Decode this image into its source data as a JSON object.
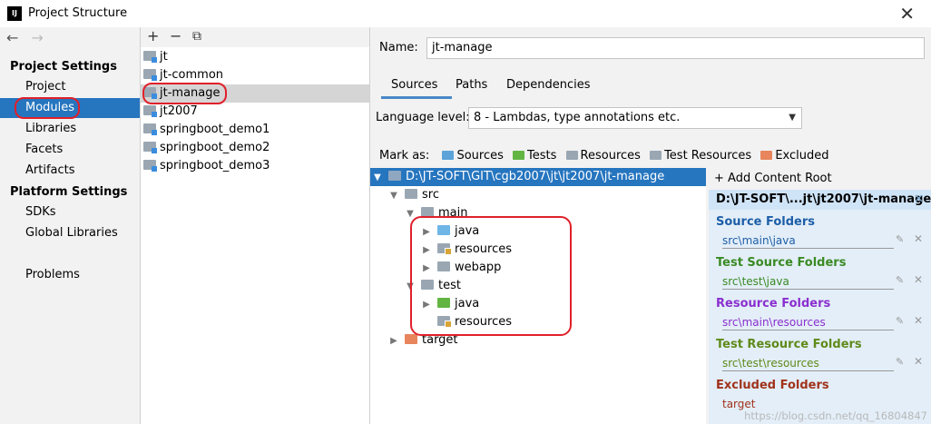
{
  "window": {
    "title": "Project Structure",
    "app_icon": "IJ"
  },
  "left": {
    "project_settings_header": "Project Settings",
    "project_items": [
      "Project",
      "Modules",
      "Libraries",
      "Facets",
      "Artifacts"
    ],
    "platform_settings_header": "Platform Settings",
    "platform_items": [
      "SDKs",
      "Global Libraries"
    ],
    "problems": "Problems",
    "selected": "Modules"
  },
  "modules": {
    "toolbar": {
      "add": "+",
      "remove": "−",
      "copy": "⧉"
    },
    "items": [
      "jt",
      "jt-common",
      "jt-manage",
      "jt2007",
      "springboot_demo1",
      "springboot_demo2",
      "springboot_demo3"
    ],
    "selected": "jt-manage"
  },
  "detail": {
    "name_label": "Name:",
    "name_value": "jt-manage",
    "tabs": [
      "Sources",
      "Paths",
      "Dependencies"
    ],
    "active_tab": "Sources",
    "language_level_label": "Language level:",
    "language_level_value": "8 - Lambdas, type annotations etc.",
    "mark_as_label": "Mark as:",
    "mark_as": [
      {
        "label": "Sources",
        "color": "#5ba3d9"
      },
      {
        "label": "Tests",
        "color": "#62b543"
      },
      {
        "label": "Resources",
        "color": "#9aa7b3"
      },
      {
        "label": "Test Resources",
        "color": "#9aa7b3"
      },
      {
        "label": "Excluded",
        "color": "#e8855c"
      }
    ]
  },
  "tree": {
    "root": "D:\\JT-SOFT\\GIT\\cgb2007\\jt\\jt2007\\jt-manage",
    "nodes": [
      "src",
      "main",
      "java",
      "resources",
      "webapp",
      "test",
      "java",
      "resources",
      "target"
    ]
  },
  "roots": {
    "add_content_root": "+ Add Content Root",
    "path": "D:\\JT-SOFT\\...jt\\jt2007\\jt-manage",
    "sections": [
      {
        "title": "Source Folders",
        "path": "src\\main\\java",
        "color": "#1d5ea8"
      },
      {
        "title": "Test Source Folders",
        "path": "src\\test\\java",
        "color": "#3a8a24"
      },
      {
        "title": "Resource Folders",
        "path": "src\\main\\resources",
        "color": "#8a2fcf"
      },
      {
        "title": "Test Resource Folders",
        "path": "src\\test\\resources",
        "color": "#5f8a1a"
      },
      {
        "title": "Excluded Folders",
        "path": "target",
        "color": "#a0331c"
      }
    ],
    "watermark": "https://blog.csdn.net/qq_16804847"
  }
}
